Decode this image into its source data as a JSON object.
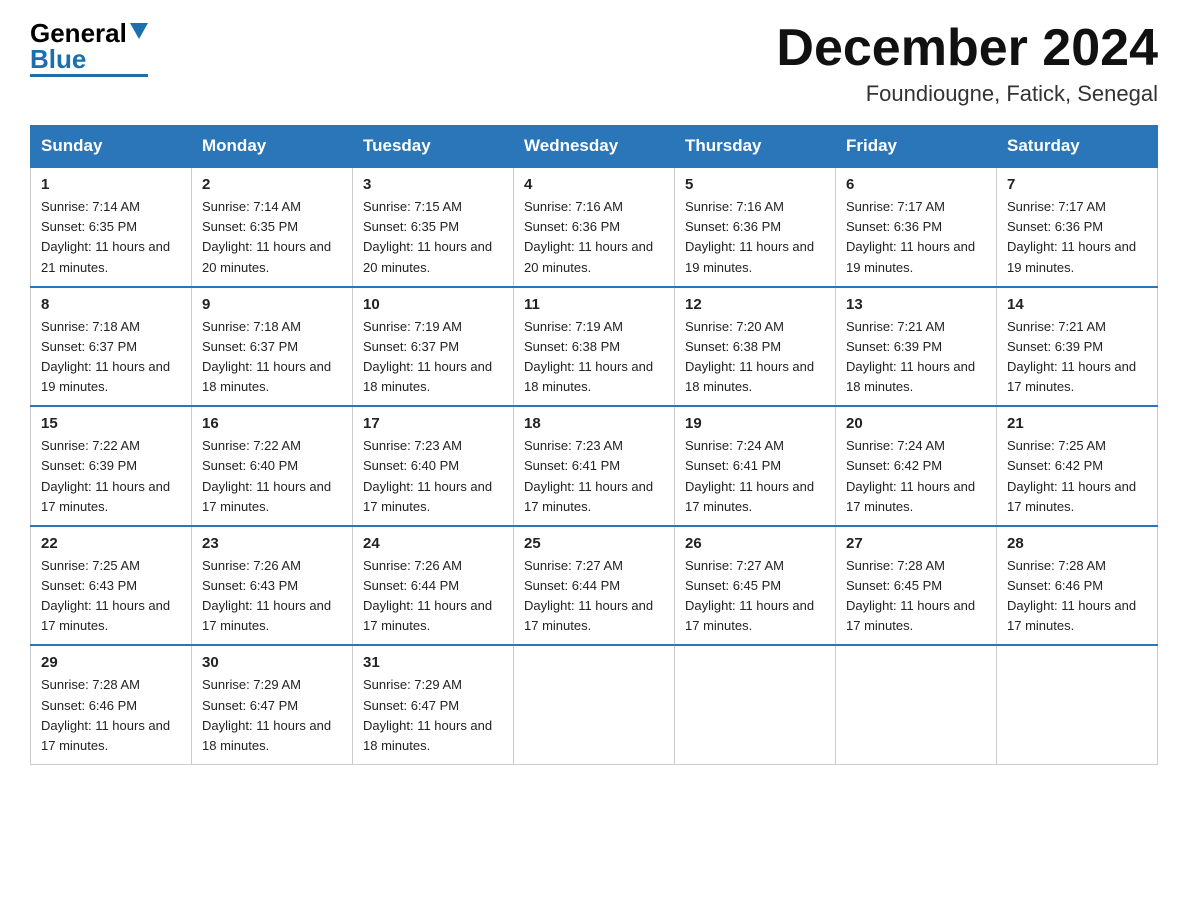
{
  "logo": {
    "general": "General",
    "blue": "Blue"
  },
  "header": {
    "month": "December 2024",
    "location": "Foundiougne, Fatick, Senegal"
  },
  "days_of_week": [
    "Sunday",
    "Monday",
    "Tuesday",
    "Wednesday",
    "Thursday",
    "Friday",
    "Saturday"
  ],
  "weeks": [
    [
      {
        "day": "1",
        "sunrise": "7:14 AM",
        "sunset": "6:35 PM",
        "daylight": "11 hours and 21 minutes."
      },
      {
        "day": "2",
        "sunrise": "7:14 AM",
        "sunset": "6:35 PM",
        "daylight": "11 hours and 20 minutes."
      },
      {
        "day": "3",
        "sunrise": "7:15 AM",
        "sunset": "6:35 PM",
        "daylight": "11 hours and 20 minutes."
      },
      {
        "day": "4",
        "sunrise": "7:16 AM",
        "sunset": "6:36 PM",
        "daylight": "11 hours and 20 minutes."
      },
      {
        "day": "5",
        "sunrise": "7:16 AM",
        "sunset": "6:36 PM",
        "daylight": "11 hours and 19 minutes."
      },
      {
        "day": "6",
        "sunrise": "7:17 AM",
        "sunset": "6:36 PM",
        "daylight": "11 hours and 19 minutes."
      },
      {
        "day": "7",
        "sunrise": "7:17 AM",
        "sunset": "6:36 PM",
        "daylight": "11 hours and 19 minutes."
      }
    ],
    [
      {
        "day": "8",
        "sunrise": "7:18 AM",
        "sunset": "6:37 PM",
        "daylight": "11 hours and 19 minutes."
      },
      {
        "day": "9",
        "sunrise": "7:18 AM",
        "sunset": "6:37 PM",
        "daylight": "11 hours and 18 minutes."
      },
      {
        "day": "10",
        "sunrise": "7:19 AM",
        "sunset": "6:37 PM",
        "daylight": "11 hours and 18 minutes."
      },
      {
        "day": "11",
        "sunrise": "7:19 AM",
        "sunset": "6:38 PM",
        "daylight": "11 hours and 18 minutes."
      },
      {
        "day": "12",
        "sunrise": "7:20 AM",
        "sunset": "6:38 PM",
        "daylight": "11 hours and 18 minutes."
      },
      {
        "day": "13",
        "sunrise": "7:21 AM",
        "sunset": "6:39 PM",
        "daylight": "11 hours and 18 minutes."
      },
      {
        "day": "14",
        "sunrise": "7:21 AM",
        "sunset": "6:39 PM",
        "daylight": "11 hours and 17 minutes."
      }
    ],
    [
      {
        "day": "15",
        "sunrise": "7:22 AM",
        "sunset": "6:39 PM",
        "daylight": "11 hours and 17 minutes."
      },
      {
        "day": "16",
        "sunrise": "7:22 AM",
        "sunset": "6:40 PM",
        "daylight": "11 hours and 17 minutes."
      },
      {
        "day": "17",
        "sunrise": "7:23 AM",
        "sunset": "6:40 PM",
        "daylight": "11 hours and 17 minutes."
      },
      {
        "day": "18",
        "sunrise": "7:23 AM",
        "sunset": "6:41 PM",
        "daylight": "11 hours and 17 minutes."
      },
      {
        "day": "19",
        "sunrise": "7:24 AM",
        "sunset": "6:41 PM",
        "daylight": "11 hours and 17 minutes."
      },
      {
        "day": "20",
        "sunrise": "7:24 AM",
        "sunset": "6:42 PM",
        "daylight": "11 hours and 17 minutes."
      },
      {
        "day": "21",
        "sunrise": "7:25 AM",
        "sunset": "6:42 PM",
        "daylight": "11 hours and 17 minutes."
      }
    ],
    [
      {
        "day": "22",
        "sunrise": "7:25 AM",
        "sunset": "6:43 PM",
        "daylight": "11 hours and 17 minutes."
      },
      {
        "day": "23",
        "sunrise": "7:26 AM",
        "sunset": "6:43 PM",
        "daylight": "11 hours and 17 minutes."
      },
      {
        "day": "24",
        "sunrise": "7:26 AM",
        "sunset": "6:44 PM",
        "daylight": "11 hours and 17 minutes."
      },
      {
        "day": "25",
        "sunrise": "7:27 AM",
        "sunset": "6:44 PM",
        "daylight": "11 hours and 17 minutes."
      },
      {
        "day": "26",
        "sunrise": "7:27 AM",
        "sunset": "6:45 PM",
        "daylight": "11 hours and 17 minutes."
      },
      {
        "day": "27",
        "sunrise": "7:28 AM",
        "sunset": "6:45 PM",
        "daylight": "11 hours and 17 minutes."
      },
      {
        "day": "28",
        "sunrise": "7:28 AM",
        "sunset": "6:46 PM",
        "daylight": "11 hours and 17 minutes."
      }
    ],
    [
      {
        "day": "29",
        "sunrise": "7:28 AM",
        "sunset": "6:46 PM",
        "daylight": "11 hours and 17 minutes."
      },
      {
        "day": "30",
        "sunrise": "7:29 AM",
        "sunset": "6:47 PM",
        "daylight": "11 hours and 18 minutes."
      },
      {
        "day": "31",
        "sunrise": "7:29 AM",
        "sunset": "6:47 PM",
        "daylight": "11 hours and 18 minutes."
      },
      null,
      null,
      null,
      null
    ]
  ],
  "labels": {
    "sunrise": "Sunrise:",
    "sunset": "Sunset:",
    "daylight": "Daylight:"
  }
}
